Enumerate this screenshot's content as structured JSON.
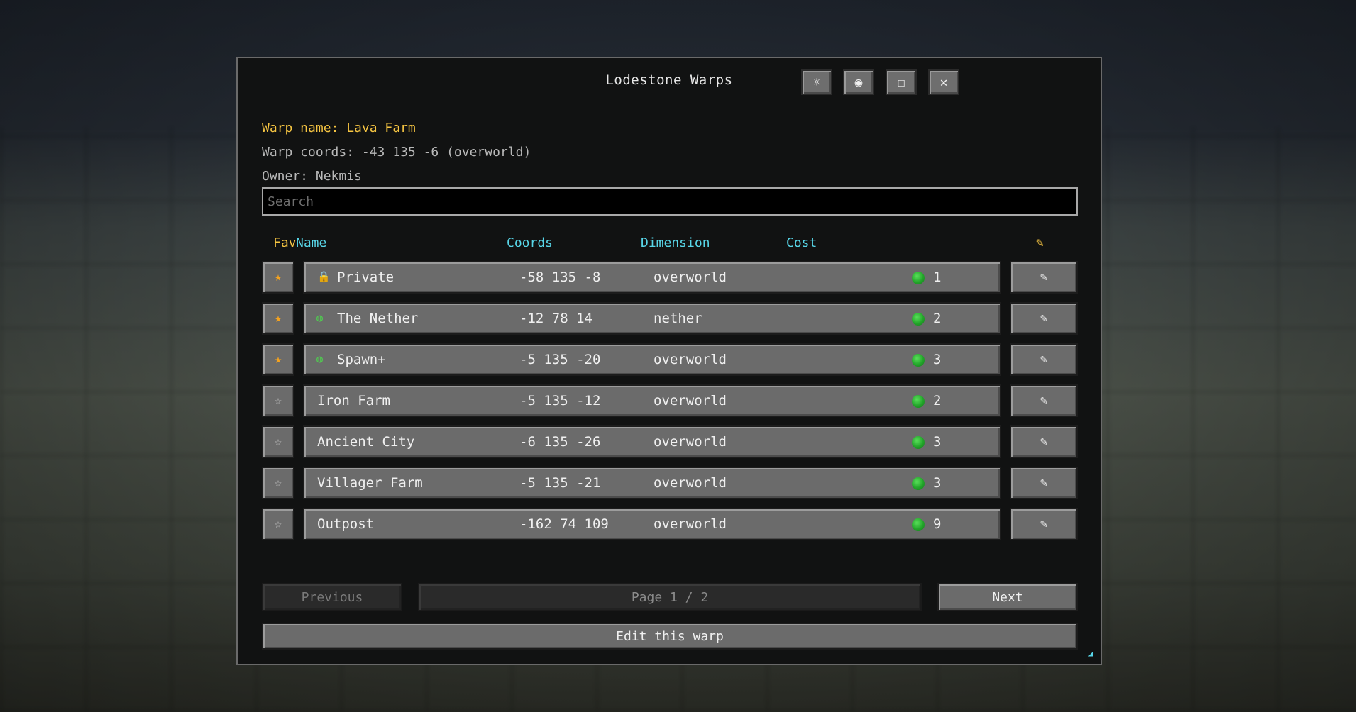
{
  "window": {
    "title": "Lodestone Warps"
  },
  "title_buttons": [
    {
      "name": "settings-icon",
      "glyph": "☼"
    },
    {
      "name": "record-icon",
      "glyph": "◉"
    },
    {
      "name": "maximize-icon",
      "glyph": "☐"
    },
    {
      "name": "close-icon",
      "glyph": "✕"
    }
  ],
  "info": {
    "warp_name": "Warp name: Lava Farm",
    "warp_coords": "Warp coords: -43 135 -6 (overworld)",
    "owner": "Owner: Nekmis"
  },
  "search": {
    "placeholder": "Search",
    "value": ""
  },
  "columns": {
    "fav": "Fav",
    "name": "Name",
    "coords": "Coords",
    "dimension": "Dimension",
    "cost": "Cost",
    "edit_glyph": "✎"
  },
  "rows": [
    {
      "fav": true,
      "fav_glyph": "★",
      "icon": "🔒",
      "name": "Private",
      "coords": "-58 135 -8",
      "dimension": "overworld",
      "cost": "1"
    },
    {
      "fav": true,
      "fav_glyph": "★",
      "icon": "◍",
      "name": "The Nether",
      "coords": "-12 78 14",
      "dimension": "nether",
      "cost": "2"
    },
    {
      "fav": true,
      "fav_glyph": "★",
      "icon": "◍",
      "name": "Spawn+",
      "coords": "-5 135 -20",
      "dimension": "overworld",
      "cost": "3"
    },
    {
      "fav": false,
      "fav_glyph": "☆",
      "icon": "",
      "name": "Iron Farm",
      "coords": "-5 135 -12",
      "dimension": "overworld",
      "cost": "2"
    },
    {
      "fav": false,
      "fav_glyph": "☆",
      "icon": "",
      "name": "Ancient City",
      "coords": "-6 135 -26",
      "dimension": "overworld",
      "cost": "3"
    },
    {
      "fav": false,
      "fav_glyph": "☆",
      "icon": "",
      "name": "Villager Farm",
      "coords": "-5 135 -21",
      "dimension": "overworld",
      "cost": "3"
    },
    {
      "fav": false,
      "fav_glyph": "☆",
      "icon": "",
      "name": "Outpost",
      "coords": "-162 74 109",
      "dimension": "overworld",
      "cost": "9"
    }
  ],
  "pagination": {
    "previous": "Previous",
    "page": "Page 1 / 2",
    "next": "Next"
  },
  "actions": {
    "edit_warp": "Edit this warp",
    "resize_glyph": "◢"
  },
  "colors": {
    "accent_yellow": "#f6c542",
    "accent_cyan": "#58d6e8",
    "cost_green": "#23a52a"
  }
}
